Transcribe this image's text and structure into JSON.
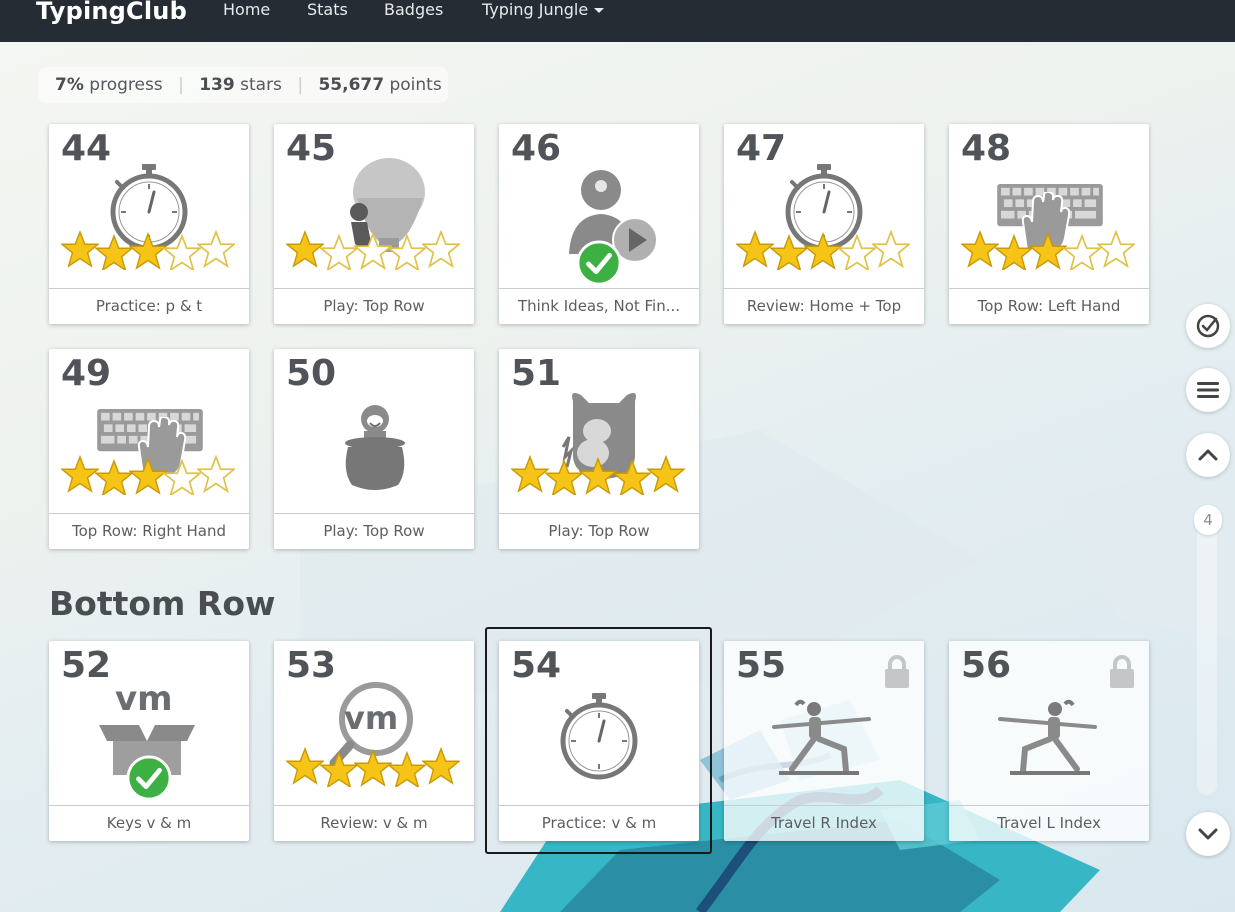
{
  "nav": {
    "brand": "TypingClub",
    "links": [
      "Home",
      "Stats",
      "Badges",
      "Typing Jungle"
    ]
  },
  "summary": {
    "progress_value": "7%",
    "progress_label": "progress",
    "stars_value": "139",
    "stars_label": "stars",
    "points_value": "55,677",
    "points_label": "points"
  },
  "lessons": [
    {
      "num": "44",
      "title": "Practice: p & t",
      "icon": "stopwatch-icon",
      "stars": 3,
      "status": "done"
    },
    {
      "num": "45",
      "title": "Play: Top Row",
      "icon": "balloon-game-icon",
      "stars": 1,
      "status": "done"
    },
    {
      "num": "46",
      "title": "Think Ideas, Not Fin...",
      "icon": "video-lesson-icon",
      "stars": 0,
      "status": "done-check"
    },
    {
      "num": "47",
      "title": "Review: Home + Top",
      "icon": "stopwatch-icon",
      "stars": 3,
      "status": "done"
    },
    {
      "num": "48",
      "title": "Top Row: Left Hand",
      "icon": "keyboard-left-hand-icon",
      "stars": 3,
      "status": "done"
    },
    {
      "num": "49",
      "title": "Top Row: Right Hand",
      "icon": "keyboard-right-hand-icon",
      "stars": 3,
      "status": "done"
    },
    {
      "num": "50",
      "title": "Play: Top Row",
      "icon": "jar-creature-game-icon",
      "stars": 0,
      "status": "done"
    },
    {
      "num": "51",
      "title": "Play: Top Row",
      "icon": "monster-game-icon",
      "stars": 5,
      "status": "done"
    },
    {
      "num": "52",
      "title": "Keys v & m",
      "icon": "keys-box-icon",
      "stars": 0,
      "status": "done-check"
    },
    {
      "num": "53",
      "title": "Review: v & m",
      "icon": "magnifier-icon",
      "stars": 5,
      "status": "done"
    },
    {
      "num": "54",
      "title": "Practice: v & m",
      "icon": "stopwatch-icon",
      "stars": 0,
      "status": "current"
    },
    {
      "num": "55",
      "title": "Travel R Index",
      "icon": "yoga-right-icon",
      "stars": 0,
      "status": "locked"
    },
    {
      "num": "56",
      "title": "Travel L Index",
      "icon": "yoga-left-icon",
      "stars": 0,
      "status": "locked"
    }
  ],
  "section": {
    "title": "Bottom Row"
  },
  "key_icon_text": {
    "keys": "vm",
    "magnifier": "vm"
  },
  "sidebar": {
    "page_indicator": "4"
  },
  "colors": {
    "navbar": "#252c34",
    "star": "#f5c518",
    "check": "#3cb043",
    "icon_gray": "#808080"
  }
}
